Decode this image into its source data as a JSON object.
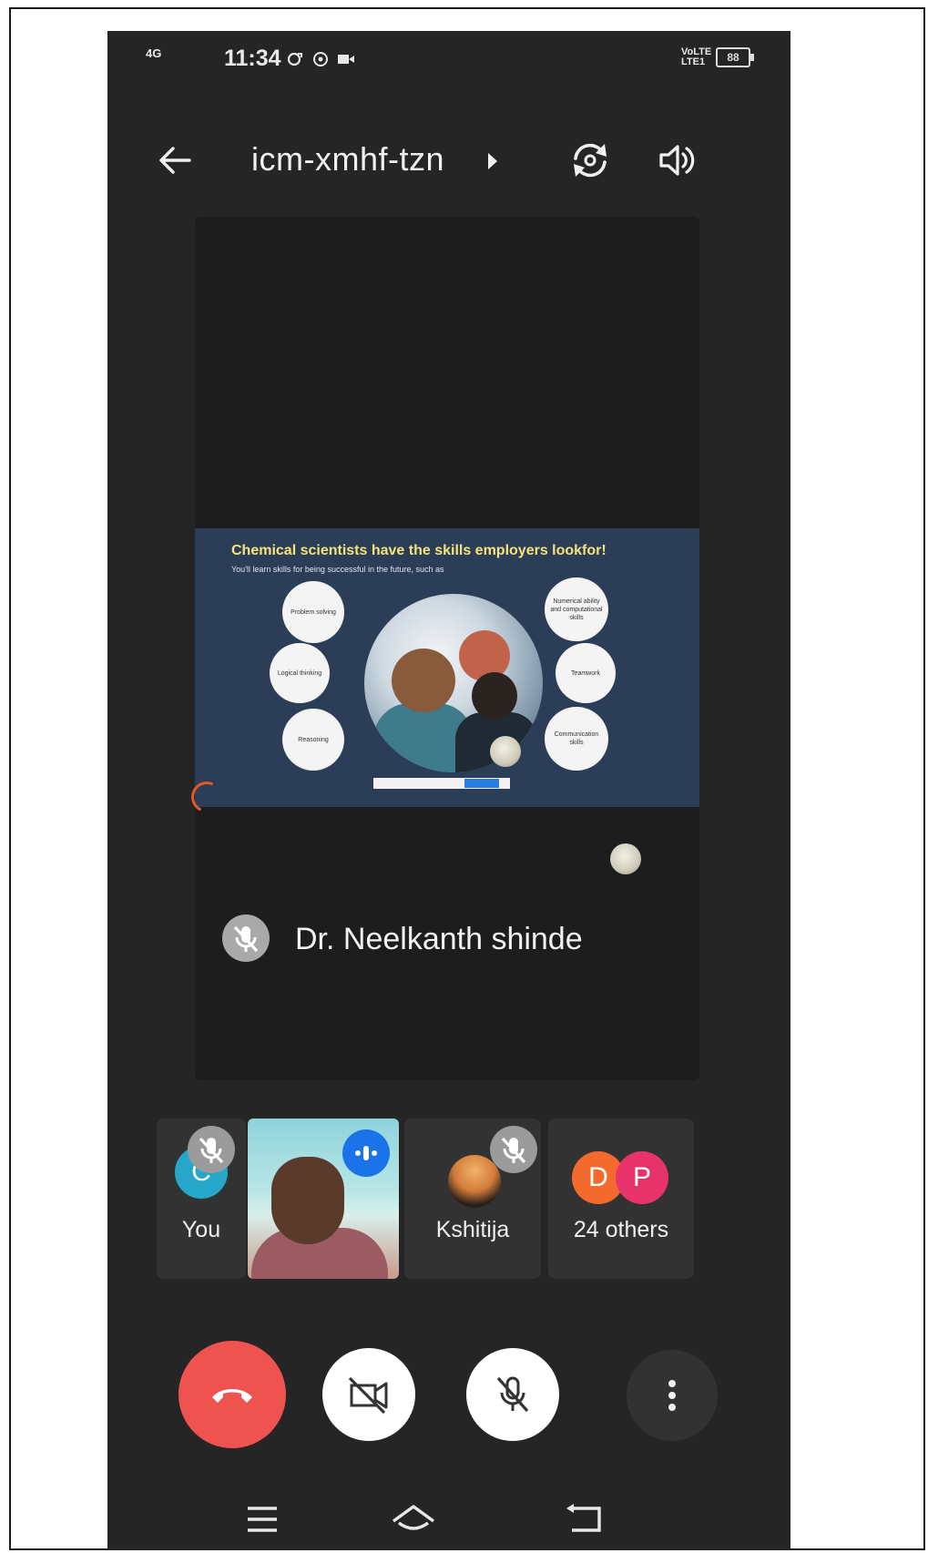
{
  "status_bar": {
    "network": "4G",
    "time": "11:34",
    "volte": "VoLTE LTE1",
    "battery": "88"
  },
  "header": {
    "meeting_code": "icm-xmhf-tzn"
  },
  "main_tile": {
    "slide_title": "Chemical scientists have the skills employers lookfor!",
    "slide_subtitle": "You'll learn skills for being successful in the future, such as",
    "bubbles": [
      "Problem solving",
      "Logical thinking",
      "Reasoning",
      "Numerical ability and computational skills",
      "Teamwork",
      "Communication skills"
    ],
    "speaker_name": "Dr. Neelkanth shinde"
  },
  "participants": {
    "you": {
      "initial": "C",
      "label": "You",
      "color": "#26a6c9"
    },
    "kshitija": {
      "label": "Kshitija"
    },
    "others": {
      "initial1": "D",
      "initial2": "P",
      "label": "24 others",
      "color1": "#f26a2e",
      "color2": "#e8336a"
    }
  },
  "icons": {
    "back": "arrow-left-icon",
    "info": "caret-right-icon",
    "rotate": "switch-camera-icon",
    "audio": "speaker-icon",
    "end": "hang-up-icon",
    "camera": "camera-off-icon",
    "mic": "mic-off-icon",
    "more": "more-vertical-icon"
  }
}
